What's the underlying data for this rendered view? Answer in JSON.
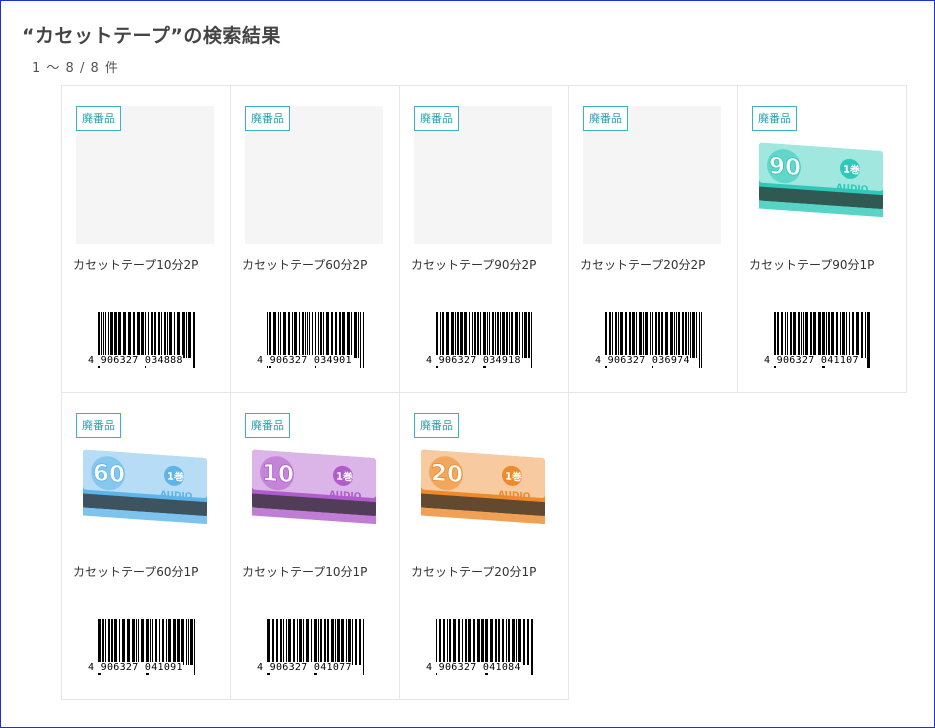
{
  "search": {
    "title": "“カセットテープ”の検索結果",
    "count": "1 ～ 8 / 8 件"
  },
  "products": [
    {
      "badge": "廃番品",
      "name": "カセットテープ10分2P",
      "jan": "4 906327 034888",
      "image": "none",
      "color": ""
    },
    {
      "badge": "廃番品",
      "name": "カセットテープ60分2P",
      "jan": "4 906327 034901",
      "image": "none",
      "color": ""
    },
    {
      "badge": "廃番品",
      "name": "カセットテープ90分2P",
      "jan": "4 906327 034918",
      "image": "none",
      "color": ""
    },
    {
      "badge": "廃番品",
      "name": "カセットテープ20分2P",
      "jan": "4 906327 036974",
      "image": "none",
      "color": ""
    },
    {
      "badge": "廃番品",
      "name": "カセットテープ90分1P",
      "jan": "4 906327 041107",
      "image": "cassette-box",
      "color": "#2ec9b8",
      "box_number": "90",
      "box_label": "1巻",
      "box_brand": "AUDIO"
    },
    {
      "badge": "廃番品",
      "name": "カセットテープ60分1P",
      "jan": "4 906327 041091",
      "image": "cassette-box",
      "color": "#5db4e8",
      "box_number": "60",
      "box_label": "1巻",
      "box_brand": "AUDIO"
    },
    {
      "badge": "廃番品",
      "name": "カセットテープ10分1P",
      "jan": "4 906327 041077",
      "image": "cassette-box",
      "color": "#b05ccc",
      "box_number": "10",
      "box_label": "1巻",
      "box_brand": "AUDIO"
    },
    {
      "badge": "廃番品",
      "name": "カセットテープ20分1P",
      "jan": "4 906327 041084",
      "image": "cassette-box",
      "color": "#ee8a2a",
      "box_number": "20",
      "box_label": "1巻",
      "box_brand": "AUDIO"
    }
  ],
  "colors": {
    "badge": "#2a9fae",
    "frame": "#1f2fd8"
  }
}
